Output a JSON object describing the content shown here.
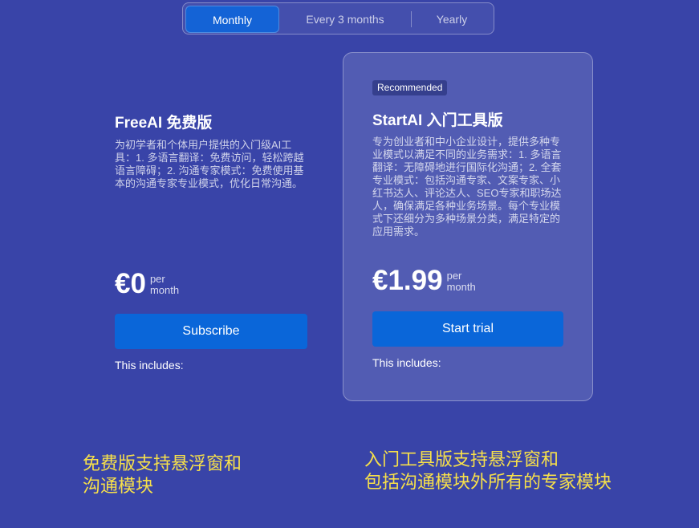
{
  "billing_toggle": {
    "options": [
      {
        "label": "Monthly",
        "selected": true
      },
      {
        "label": "Every 3 months",
        "selected": false
      },
      {
        "label": "Yearly",
        "selected": false
      }
    ]
  },
  "plans": [
    {
      "title": "FreeAI 免费版",
      "description": "为初学者和个体用户提供的入门级AI工具：1. 多语言翻译：免费访问，轻松跨越语言障碍；2. 沟通专家模式：免费使用基本的沟通专家专业模式，优化日常沟通。",
      "price": "€0",
      "period_line1": "per",
      "period_line2": "month",
      "button_label": "Subscribe",
      "includes_label": "This includes:"
    },
    {
      "badge": "Recommended",
      "title": "StartAI 入门工具版",
      "description": "专为创业者和中小企业设计，提供多种专业模式以满足不同的业务需求：1. 多语言翻译：无障碍地进行国际化沟通；2. 全套专业模式：包括沟通专家、文案专家、小红书达人、评论达人、SEO专家和职场达人，确保满足各种业务场景。每个专业模式下还细分为多种场景分类，满足特定的应用需求。",
      "price": "€1.99",
      "period_line1": "per",
      "period_line2": "month",
      "button_label": "Start trial",
      "includes_label": "This includes:"
    }
  ],
  "annotations": [
    {
      "line1": "免费版支持悬浮窗和",
      "line2": "沟通模块"
    },
    {
      "line1": "入门工具版支持悬浮窗和",
      "line2": "包括沟通模块外所有的专家模块"
    }
  ],
  "colors": {
    "background": "#3944a8",
    "accent_button": "#0a66d9",
    "annotation_text": "#f7e04a"
  }
}
